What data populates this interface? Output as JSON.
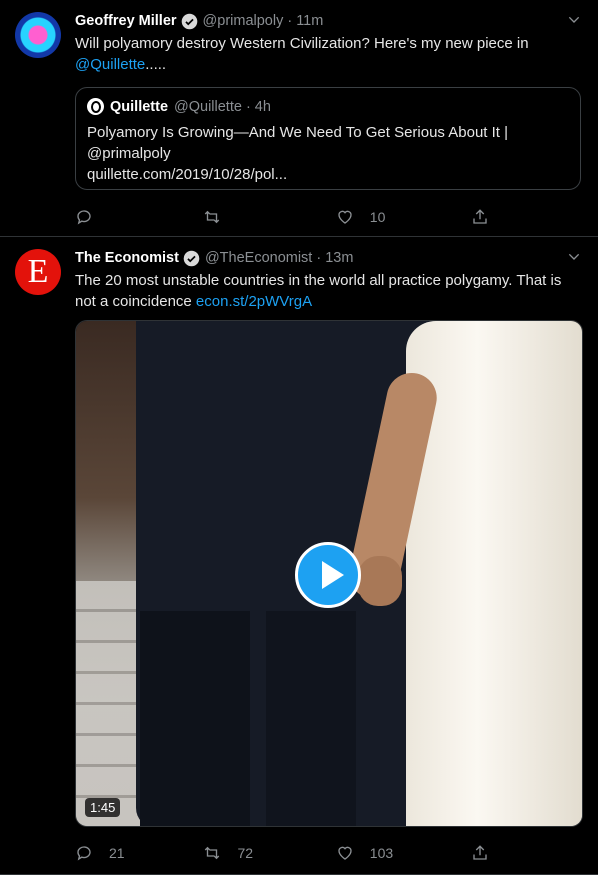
{
  "tweets": [
    {
      "author": "Geoffrey Miller",
      "handle": "@primalpoly",
      "time": "11m",
      "text_before_link": "Will polyamory destroy Western Civilization? Here's my new piece in ",
      "text_link": "@Quillette",
      "text_after_link": ".....",
      "quote": {
        "author": "Quillette",
        "handle": "@Quillette",
        "time": "4h",
        "text": "Polyamory Is Growing—And We Need To Get Serious About It | @primalpoly",
        "url": "quillette.com/2019/10/28/pol..."
      },
      "actions": {
        "reply": "",
        "retweet": "",
        "like": "10"
      }
    },
    {
      "author": "The Economist",
      "avatar_letter": "E",
      "handle": "@TheEconomist",
      "time": "13m",
      "text_before_link": "The 20 most unstable countries in the world all practice polygamy. That is not a coincidence ",
      "text_link": "econ.st/2pWVrgA",
      "media": {
        "duration": "1:45"
      },
      "actions": {
        "reply": "21",
        "retweet": "72",
        "like": "103"
      }
    }
  ],
  "colors": {
    "accent": "#1da1f2",
    "background": "#000000",
    "muted": "#8b8f93"
  },
  "icons": [
    "verified-icon",
    "chevron-down-icon",
    "reply-icon",
    "retweet-icon",
    "like-icon",
    "share-icon",
    "play-icon"
  ]
}
